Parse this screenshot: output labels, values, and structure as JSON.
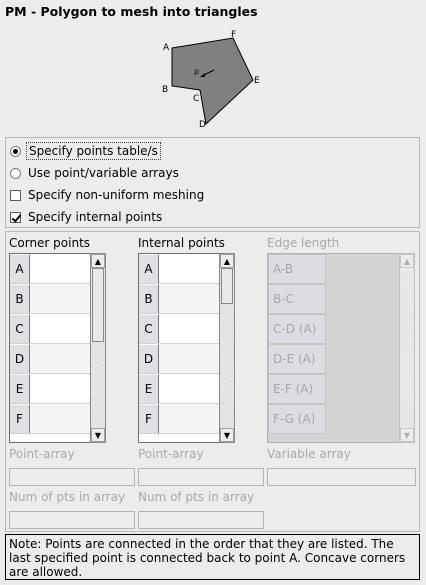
{
  "window": {
    "title": "PM - Polygon to mesh into triangles"
  },
  "diagram": {
    "vertex_labels": [
      "A",
      "B",
      "C",
      "D",
      "E",
      "F"
    ],
    "center_label": "ρ"
  },
  "options": {
    "items": [
      {
        "label": "Specify points table/s",
        "type": "radio",
        "checked": true
      },
      {
        "label": "Use point/variable arrays",
        "type": "radio",
        "checked": false
      },
      {
        "label": "Specify non-uniform meshing",
        "type": "checkbox",
        "checked": false
      },
      {
        "label": "Specify internal points",
        "type": "checkbox",
        "checked": true
      }
    ]
  },
  "tables": {
    "corner": {
      "header": "Corner points",
      "rows": [
        "A",
        "B",
        "C",
        "D",
        "E",
        "F"
      ]
    },
    "internal": {
      "header": "Internal points",
      "rows": [
        "A",
        "B",
        "C",
        "D",
        "E",
        "F"
      ]
    },
    "edge": {
      "header": "Edge length",
      "rows": [
        "A-B",
        "B-C",
        "C-D (A)",
        "D-E (A)",
        "E-F (A)",
        "F-G (A)"
      ]
    }
  },
  "fields": {
    "point_array_1": "Point-array",
    "point_array_2": "Point-array",
    "variable_array": "Variable array",
    "num_pts_1": "Num of pts in array",
    "num_pts_2": "Num of pts in array"
  },
  "note": "Note: Points are connected in the order that they are listed. The last specified point is connected back to point A. Concave corners are allowed."
}
